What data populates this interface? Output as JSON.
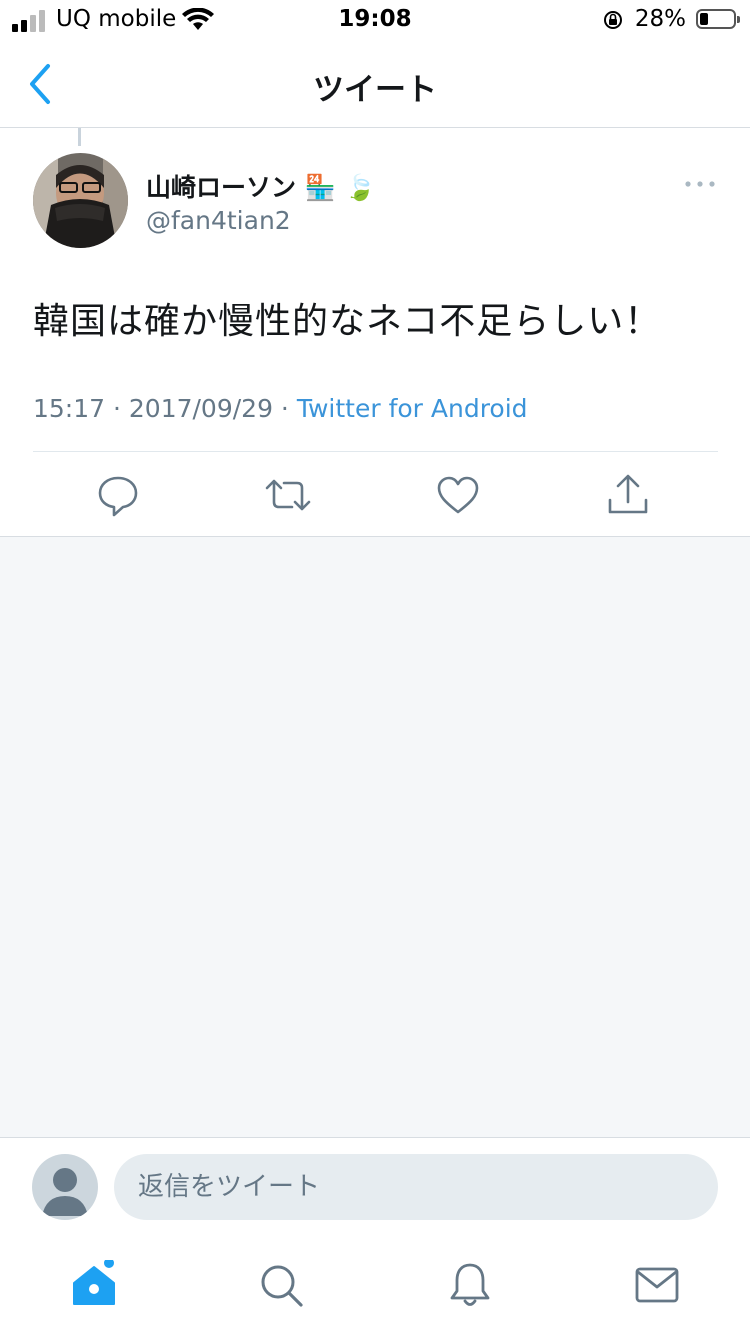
{
  "status_bar": {
    "carrier": "UQ mobile",
    "time": "19:08",
    "battery_percent": "28%",
    "battery_level": 0.28
  },
  "nav": {
    "title": "ツイート",
    "back_icon": "chevron-left-icon"
  },
  "tweet": {
    "display_name": "山崎ローソン",
    "name_emoji": "🏪",
    "name_emoji_2": "🍃",
    "handle": "@fan4tian2",
    "text": "韓国は確か慢性的なネコ不足らしい！",
    "time": "15:17",
    "date": "2017/09/29",
    "separator": " · ",
    "source": "Twitter for Android"
  },
  "actions": [
    "reply-icon",
    "retweet-icon",
    "like-icon",
    "share-icon"
  ],
  "reply": {
    "placeholder": "返信をツイート"
  },
  "tabs": [
    "home-icon",
    "search-icon",
    "notifications-icon",
    "messages-icon"
  ],
  "colors": {
    "accent": "#1da1f2",
    "link": "#3b94d9",
    "icon": "#657786",
    "background_gray": "#f5f7f9"
  }
}
